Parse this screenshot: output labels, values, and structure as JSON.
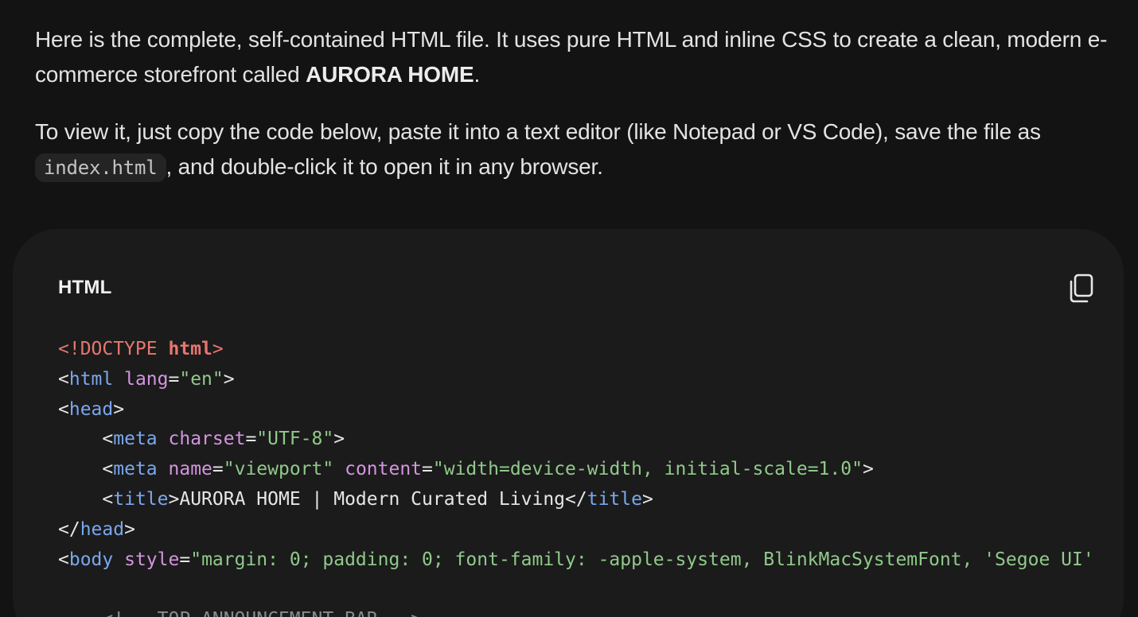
{
  "message": {
    "para1": {
      "before": "Here is the complete, self-contained HTML file. It uses pure HTML and inline CSS to create a clean, modern e-commerce storefront called ",
      "brand": "AURORA HOME",
      "after": "."
    },
    "para2": {
      "before": "To view it, just copy the code below, paste it into a text editor (like Notepad or VS Code), save the file as ",
      "code": "index.html",
      "after": ", and double-click it to open it in any browser."
    }
  },
  "code_block": {
    "language_label": "HTML",
    "copy_icon": "copy-icon",
    "lines": [
      [
        [
          "decl",
          "<!DOCTYPE "
        ],
        [
          "decl-kw",
          "html"
        ],
        [
          "decl",
          ">"
        ]
      ],
      [
        [
          "punct",
          "<"
        ],
        [
          "tag",
          "html"
        ],
        [
          "text",
          " "
        ],
        [
          "attr",
          "lang"
        ],
        [
          "punct",
          "="
        ],
        [
          "str",
          "\"en\""
        ],
        [
          "punct",
          ">"
        ]
      ],
      [
        [
          "punct",
          "<"
        ],
        [
          "tag",
          "head"
        ],
        [
          "punct",
          ">"
        ]
      ],
      [
        [
          "text",
          "    "
        ],
        [
          "punct",
          "<"
        ],
        [
          "tag",
          "meta"
        ],
        [
          "text",
          " "
        ],
        [
          "attr",
          "charset"
        ],
        [
          "punct",
          "="
        ],
        [
          "str",
          "\"UTF-8\""
        ],
        [
          "punct",
          ">"
        ]
      ],
      [
        [
          "text",
          "    "
        ],
        [
          "punct",
          "<"
        ],
        [
          "tag",
          "meta"
        ],
        [
          "text",
          " "
        ],
        [
          "attr",
          "name"
        ],
        [
          "punct",
          "="
        ],
        [
          "str",
          "\"viewport\""
        ],
        [
          "text",
          " "
        ],
        [
          "attr",
          "content"
        ],
        [
          "punct",
          "="
        ],
        [
          "str",
          "\"width=device-width, initial-scale=1.0\""
        ],
        [
          "punct",
          ">"
        ]
      ],
      [
        [
          "text",
          "    "
        ],
        [
          "punct",
          "<"
        ],
        [
          "tag",
          "title"
        ],
        [
          "punct",
          ">"
        ],
        [
          "text",
          "AURORA HOME | Modern Curated Living"
        ],
        [
          "punct",
          "</"
        ],
        [
          "tag",
          "title"
        ],
        [
          "punct",
          ">"
        ]
      ],
      [
        [
          "punct",
          "</"
        ],
        [
          "tag",
          "head"
        ],
        [
          "punct",
          ">"
        ]
      ],
      [
        [
          "punct",
          "<"
        ],
        [
          "tag",
          "body"
        ],
        [
          "text",
          " "
        ],
        [
          "attr",
          "style"
        ],
        [
          "punct",
          "="
        ],
        [
          "str",
          "\"margin: 0; padding: 0; font-family: -apple-system, BlinkMacSystemFont, 'Segoe UI'"
        ]
      ],
      [
        [
          "text",
          ""
        ]
      ],
      [
        [
          "text",
          "    "
        ],
        [
          "comment",
          "<!-- TOP ANNOUNCEMENT BAR -->"
        ]
      ]
    ]
  }
}
